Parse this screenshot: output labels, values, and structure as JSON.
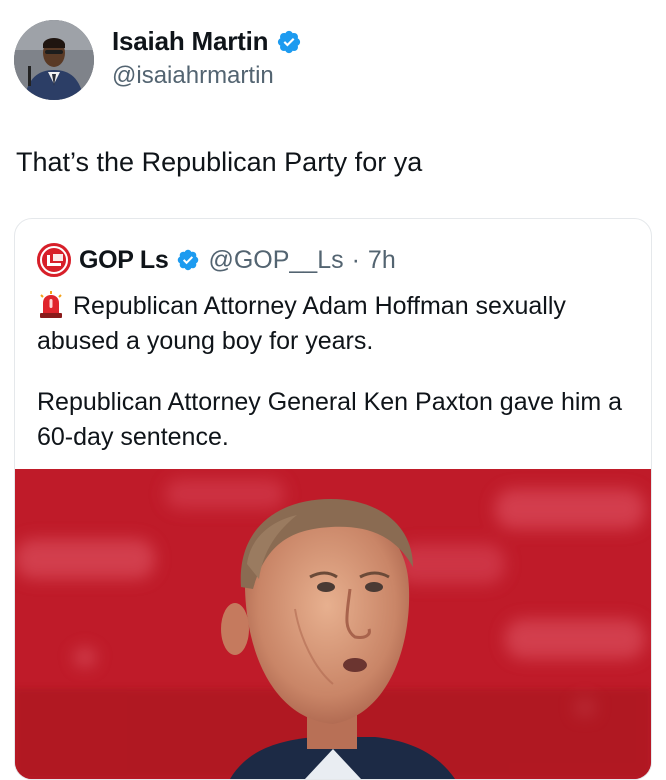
{
  "author": {
    "name": "Isaiah Martin",
    "handle": "@isaiahrmartin",
    "verified_icon": "verified-badge-icon"
  },
  "tweet": {
    "text": "That’s the Republican Party for ya"
  },
  "quoted": {
    "name": "GOP Ls",
    "handle": "@GOP__Ls",
    "separator": "·",
    "time": "7h",
    "avatar_text": "L",
    "paragraph1": "Republican Attorney Adam Hoffman sexually abused a young boy for years.",
    "paragraph2": "Republican Attorney General Ken Paxton gave him a 60-day sentence.",
    "emoji_icon": "siren-icon"
  },
  "colors": {
    "verified_blue": "#1d9bf0",
    "text_primary": "#0f1419",
    "text_secondary": "#536471",
    "photo_background": "#c41c2a"
  }
}
